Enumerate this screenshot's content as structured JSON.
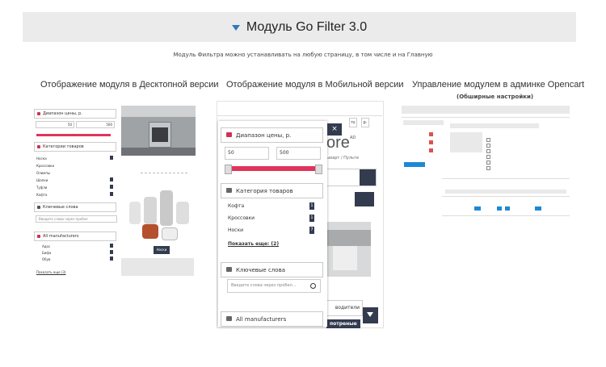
{
  "banner": {
    "title": "Модуль Go Filter 3.0",
    "icon": "filter-funnel-icon",
    "color": "#2e7bbf"
  },
  "subtitle": "Модуль Фильтра можно устанавливать на любую страницу, в том числе и на Главную",
  "columns": {
    "desktop": "Отображение модуля в Десктопной версии",
    "mobile": "Отображение модуля в Мобильной версии",
    "admin": "Управление модулем в админке Opencart",
    "admin_sub": "(Обширные настройки)"
  },
  "desktop_panel": {
    "price_label": "Диапазон цены, р.",
    "price_min": "50",
    "price_max": "500",
    "category_label": "Категории товаров",
    "categories": [
      "Носки",
      "Кроссовки",
      "Олимпы",
      "Шапки",
      "Туфли",
      "Кофта"
    ],
    "keywords_label": "Ключевые слова",
    "keywords_placeholder": "Введите слова через пробел",
    "manufacturers_label": "All manufacturers",
    "manufacturers": [
      "Адос",
      "Бифа",
      "Обув"
    ],
    "show_more": "Показать еще (3)"
  },
  "product_tag": "Носки",
  "mobile_panel": {
    "price_label": "Диапазон цены, р.",
    "price_min": "50",
    "price_max": "500",
    "category_label": "Категория товаров",
    "categories": [
      {
        "name": "Кофта",
        "count": "1"
      },
      {
        "name": "Кроссовки",
        "count": "1"
      },
      {
        "name": "Носки",
        "count": "7"
      }
    ],
    "show_more": "Показать еще: (2)",
    "keywords_label": "Ключевые слова",
    "keywords_placeholder": "Введите слова через пробел...",
    "manufacturers_label": "All manufacturers",
    "close": "×"
  },
  "mobile_back": {
    "logo": "ore",
    "logo_suffix": "AD",
    "crumb": "ьюарт / Пульте",
    "nav_a": "ru",
    "nav_b": "p.",
    "manufacturers": "водители",
    "popular": "потреные"
  },
  "accent": "#e0345a",
  "dark": "#333b4f"
}
